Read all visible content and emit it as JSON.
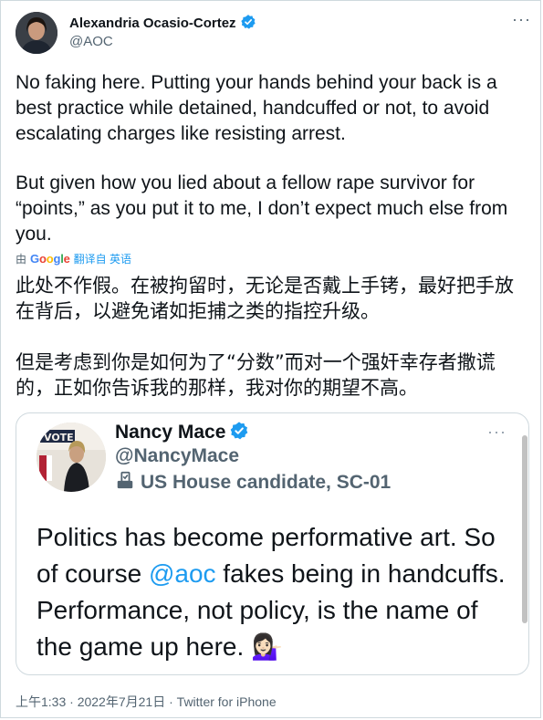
{
  "author": {
    "name": "Alexandria Ocasio-Cortez",
    "handle": "@AOC",
    "verified_color": "#1d9bf0"
  },
  "tweet": {
    "paragraph_1": "No faking here. Putting your hands behind your back is a best practice while detained, handcuffed or not, to avoid escalating charges like resisting arrest.",
    "paragraph_2": "But given how you lied about a fellow rape survivor for “points,” as you put it to me, I don’t expect much else from you."
  },
  "translation": {
    "by": "由",
    "google": "Google",
    "link": "翻译自 英语",
    "paragraph_1": "此处不作假。在被拘留时，无论是否戴上手铐，最好把手放在背后，以避免诸如拒捕之类的指控升级。",
    "paragraph_2": "但是考虑到你是如何为了“分数”而对一个强奸幸存者撒谎的，正如你告诉我的那样，我对你的期望不高。"
  },
  "quoted": {
    "name": "Nancy Mace",
    "handle": "@NancyMace",
    "label": "US House candidate, SC-01",
    "text_before": "Politics has become performative art. So of course ",
    "mention": "@aoc",
    "text_after": " fakes being in handcuffs. Performance, not policy, is the name of the game up here. ",
    "emoji": "💁🏻‍♀️"
  },
  "footer": {
    "time": "上午1:33",
    "sep": " · ",
    "date": "2022年7月21日",
    "client": "Twitter for iPhone"
  },
  "icons": [
    "verified-badge-icon",
    "more-options-icon",
    "ballot-icon"
  ]
}
